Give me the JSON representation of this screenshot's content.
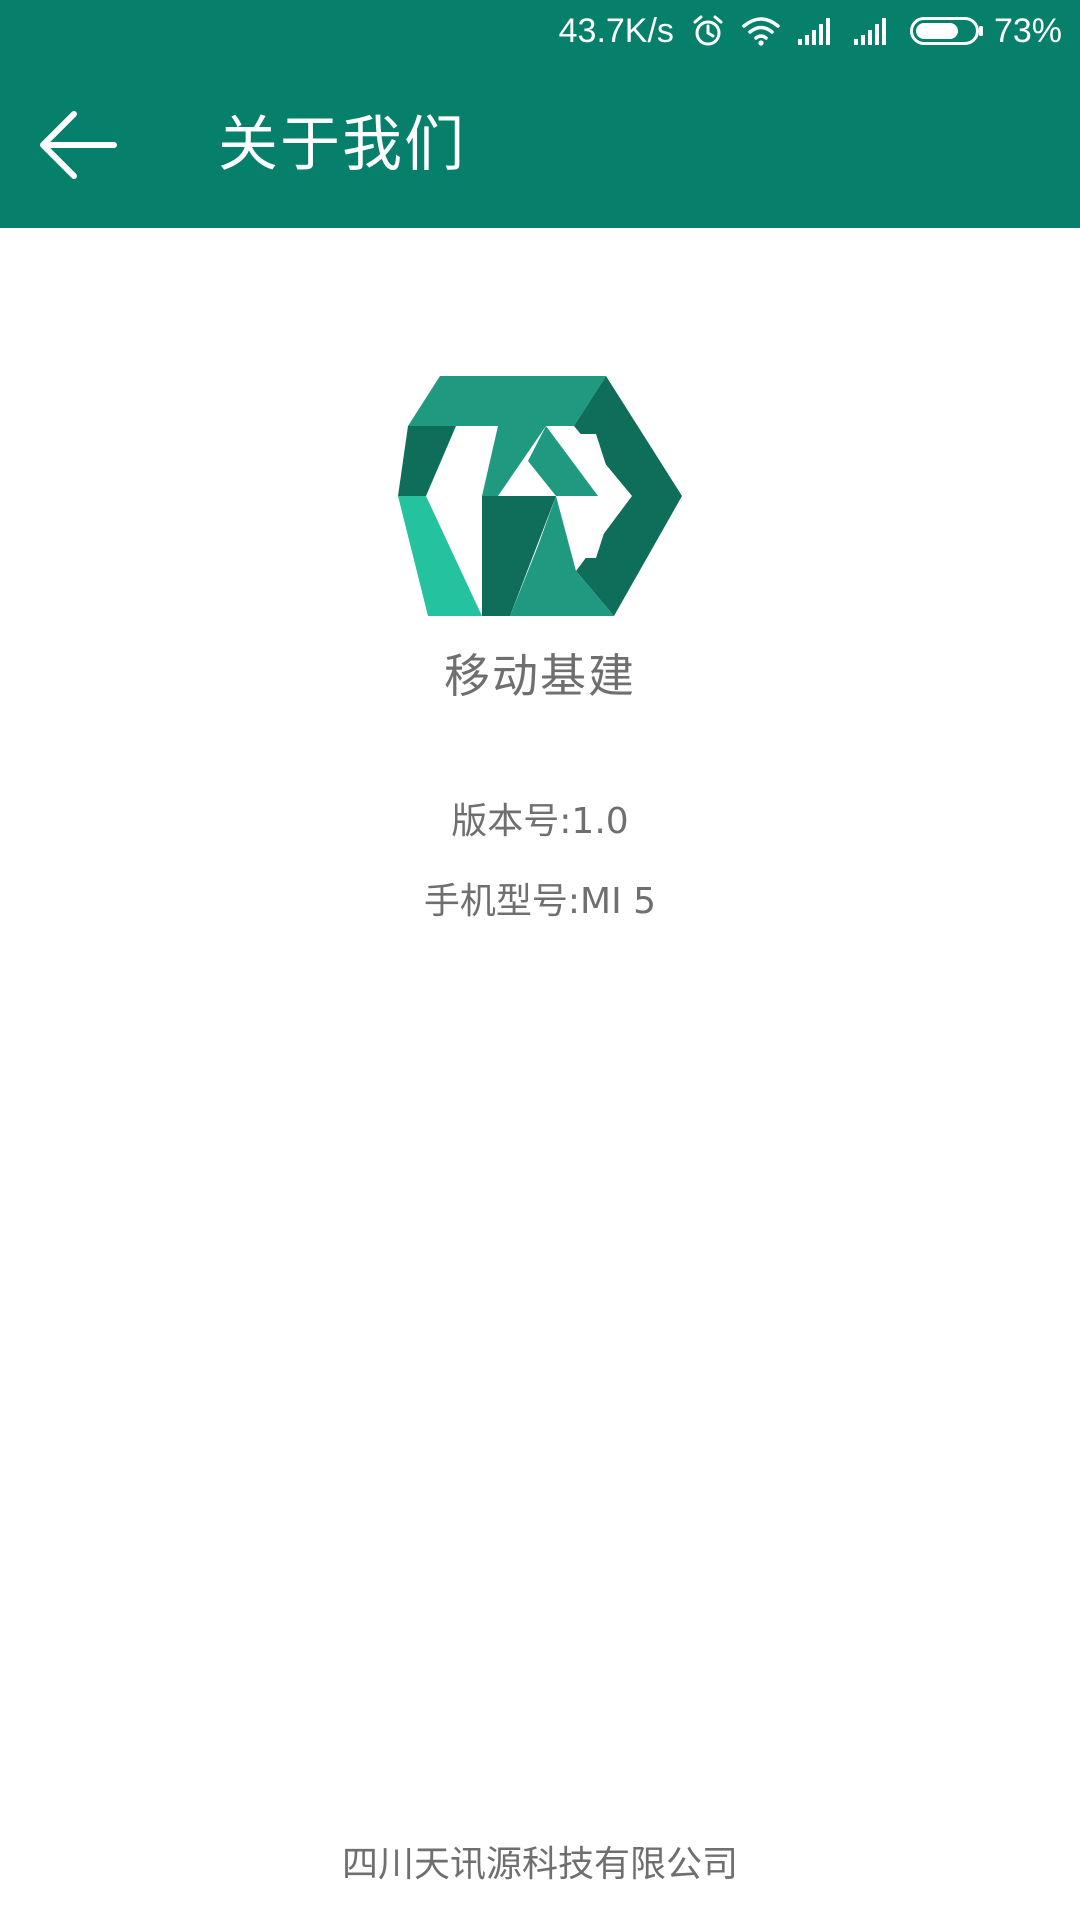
{
  "status_bar": {
    "network_speed": "43.7K/s",
    "battery_percent": "73%",
    "battery_level": 0.73,
    "icons": [
      "alarm-icon",
      "wifi-icon",
      "signal-icon",
      "signal-icon",
      "battery-icon"
    ]
  },
  "toolbar": {
    "back_icon": "arrow-left-icon",
    "title": "关于我们"
  },
  "about": {
    "app_name": "移动基建",
    "version": "版本号:1.0",
    "phone_model": "手机型号:MI 5",
    "company": "四川天讯源科技有限公司"
  },
  "colors": {
    "header_bg": "#06806B",
    "text_gray": "#6f6f6f",
    "logo_dark": "#0E6E5A",
    "logo_mid": "#1F9A80",
    "logo_light": "#25C2A0"
  }
}
